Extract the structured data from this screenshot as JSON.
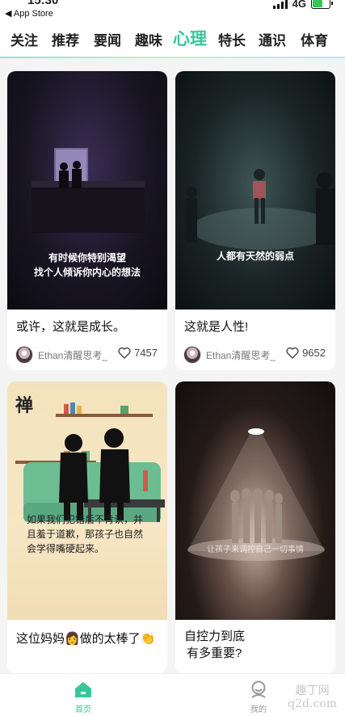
{
  "status": {
    "time": "15:30",
    "back_label": "◀ App Store",
    "network": "4G"
  },
  "tabs": {
    "items": [
      "关注",
      "推荐",
      "要闻",
      "趣味",
      "心理",
      "特长",
      "通识",
      "体育"
    ],
    "active": "心理"
  },
  "cards": [
    {
      "caption_lines": [
        "有时候你特别渴望",
        "找个人倾诉你内心的想法"
      ],
      "title": "或许，这就是成长。",
      "author": "Ethan清醒思考_",
      "likes": "7457"
    },
    {
      "caption_lines": [
        "人都有天然的弱点"
      ],
      "title": "这就是人性!",
      "author": "Ethan清醒思考_",
      "likes": "9652"
    },
    {
      "image_text": "禅",
      "caption_lines": [
        "如果我们犯错后不肯认，并",
        "且羞于道歉，那孩子也自然",
        "会学得嘴硬起来。"
      ],
      "title": "这位妈妈👩做的太棒了👏"
    },
    {
      "caption_lines": [
        "让孩子来调控自己一切事情"
      ],
      "title_lines": [
        "自控力到底",
        "有多重要?"
      ]
    }
  ],
  "nav": {
    "home": "首页",
    "mine": "我的"
  },
  "watermark": {
    "line1": "趣丁网",
    "line2": "q2d.com"
  },
  "colors": {
    "accent": "#39c69a"
  },
  "icons": {
    "home": "home-icon",
    "mine": "user-icon",
    "like": "heart-icon"
  }
}
